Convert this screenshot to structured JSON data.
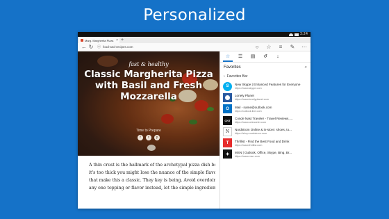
{
  "headline": "Personalized",
  "statusbar": {
    "time": "3:24"
  },
  "tab": {
    "title": "Marg. Margherita Pizza"
  },
  "address": {
    "url": "food-and-recipes.com"
  },
  "hero": {
    "script_title": "fast & healthy",
    "title": "Classic Margherita Pizza with Basil and Fresh Mozzarella",
    "author": "Time to Prepare",
    "social": [
      "f",
      "t",
      "p"
    ]
  },
  "article": {
    "lines": [
      "A thin crust is the hallmark of the archetypal pizza dish because",
      "it's too thick you might lose the nuance of the simple flavors",
      "that make this a classic. They key is being. Avoid overdoing it by",
      "any one topping or flavor instead, let the simple ingredients"
    ]
  },
  "hub": {
    "title": "Favorites",
    "folder": "Favorites Bar",
    "items": [
      {
        "title": "New Skype | Enhanced Features for Everyone",
        "url": "https://www.skype.com",
        "icon_letter": "S",
        "color": "#00aff0",
        "icon": "skype-icon"
      },
      {
        "title": "Lonely Planet",
        "url": "https://www.lonelyplanet.com",
        "icon_letter": "",
        "color": "#2a5aa0",
        "icon": "lonely-planet-icon"
      },
      {
        "title": "Mail - name@outlook.com",
        "url": "https://outlook.live.com",
        "icon_letter": "O",
        "color": "#0072c6",
        "icon": "outlook-icon"
      },
      {
        "title": "Conde Nast Traveler - Travel Reviews, ...",
        "url": "https://www.cntraveler.com",
        "icon_letter": "CNT",
        "color": "#111111",
        "icon": "cnt-icon"
      },
      {
        "title": "Nordstrom Online & in-store: shoes, to...",
        "url": "https://shop.nordstrom.com",
        "icon_letter": "N",
        "color": "#ffffff",
        "icon": "nordstrom-icon"
      },
      {
        "title": "Thrillist - Find the Best Food and Drink",
        "url": "https://www.thrillist.com",
        "icon_letter": "T",
        "color": "#e62c2c",
        "icon": "thrillist-icon"
      },
      {
        "title": "MSN | Outlook, Office, Skype, Bing, Br...",
        "url": "https://www.msn.com",
        "icon_letter": "",
        "color": "#111111",
        "icon": "msn-icon"
      }
    ]
  }
}
